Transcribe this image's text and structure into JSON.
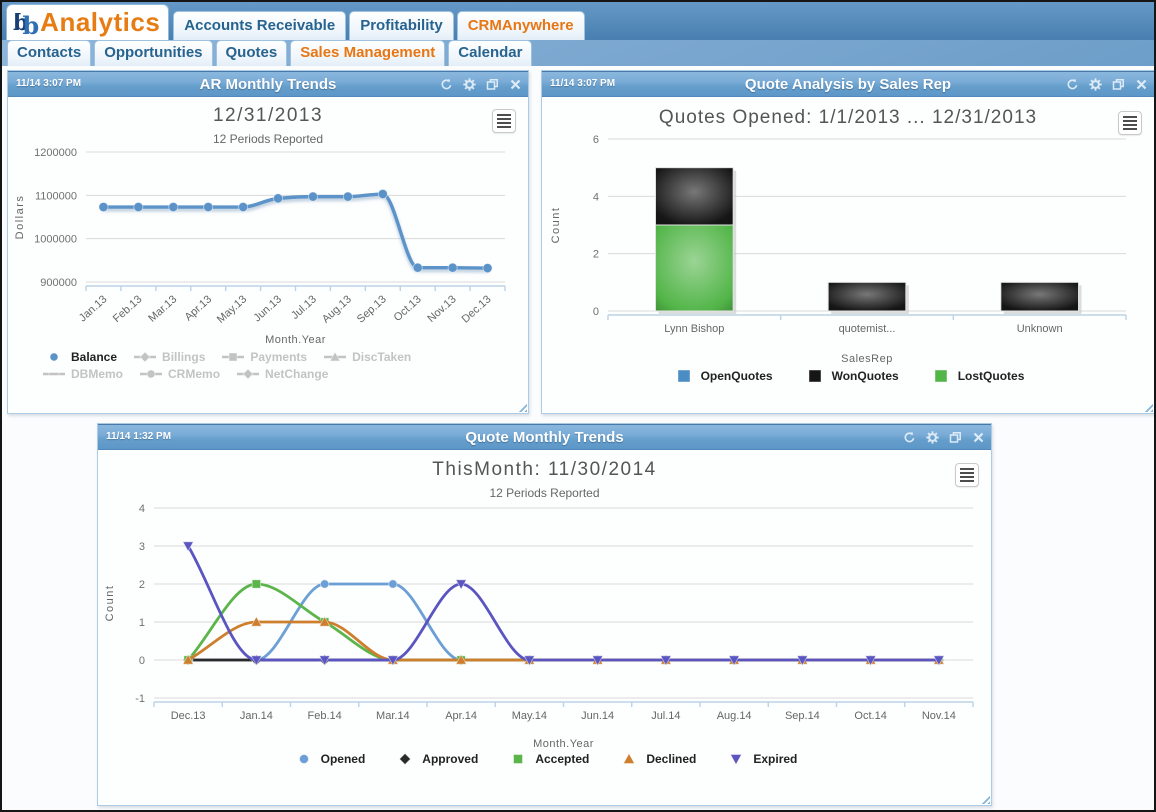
{
  "app": {
    "logo": {
      "mark_d": "d",
      "mark_b": "b",
      "text": "Analytics"
    },
    "nav_primary": [
      {
        "label": "Accounts Receivable",
        "active": false
      },
      {
        "label": "Profitability",
        "active": false
      },
      {
        "label": "CRMAnywhere",
        "active": true
      }
    ],
    "nav_secondary": [
      {
        "label": "Contacts",
        "active": false
      },
      {
        "label": "Opportunities",
        "active": false
      },
      {
        "label": "Quotes",
        "active": false
      },
      {
        "label": "Sales Management",
        "active": true
      },
      {
        "label": "Calendar",
        "active": false
      }
    ]
  },
  "panels": {
    "ar": {
      "timestamp": "11/14 3:07 PM",
      "title": "AR Monthly Trends"
    },
    "qa": {
      "timestamp": "11/14 3:07 PM",
      "title": "Quote Analysis by Sales Rep"
    },
    "qmt": {
      "timestamp": "11/14 1:32 PM",
      "title": "Quote Monthly Trends"
    }
  },
  "panel_header_icons": [
    "refresh",
    "settings",
    "popout",
    "close"
  ],
  "chart_menu_icon": "hamburger-menu",
  "chart_data": [
    {
      "id": "ar",
      "type": "line",
      "title": "12/31/2013",
      "subtitle": "12 Periods Reported",
      "xlabel": "Month.Year",
      "ylabel": "Dollars",
      "categories": [
        "Jan.13",
        "Feb.13",
        "Mar.13",
        "Apr.13",
        "May.13",
        "Jun.13",
        "Jul.13",
        "Aug.13",
        "Sep.13",
        "Oct.13",
        "Nov.13",
        "Dec.13"
      ],
      "yticks": [
        900000,
        1000000,
        1100000,
        1200000
      ],
      "ylim": [
        900000,
        1200000
      ],
      "grid": true,
      "legend_position": "bottom",
      "series": [
        {
          "name": "Balance",
          "color": "#5b93c8",
          "marker": "circle",
          "active": true,
          "values": [
            1073000,
            1073000,
            1073000,
            1073000,
            1073000,
            1093000,
            1097000,
            1097000,
            1103000,
            933000,
            933000,
            932000
          ]
        },
        {
          "name": "Billings",
          "color": "#c3c3c3",
          "marker": "diamond",
          "active": false,
          "values": null
        },
        {
          "name": "Payments",
          "color": "#c3c3c3",
          "marker": "square",
          "active": false,
          "values": null
        },
        {
          "name": "DiscTaken",
          "color": "#c3c3c3",
          "marker": "triangle-up",
          "active": false,
          "values": null
        },
        {
          "name": "DBMemo",
          "color": "#c3c3c3",
          "marker": "dash",
          "active": false,
          "values": null
        },
        {
          "name": "CRMemo",
          "color": "#c3c3c3",
          "marker": "circle",
          "active": false,
          "values": null
        },
        {
          "name": "NetChange",
          "color": "#c3c3c3",
          "marker": "diamond",
          "active": false,
          "values": null
        }
      ]
    },
    {
      "id": "qa",
      "type": "bar",
      "stacked": true,
      "title": "Quotes Opened: 1/1/2013 ... 12/31/2013",
      "xlabel": "SalesRep",
      "ylabel": "Count",
      "categories": [
        "Lynn Bishop",
        "quotemist...",
        "Unknown"
      ],
      "yticks": [
        0,
        2,
        4,
        6
      ],
      "ylim": [
        0,
        6
      ],
      "grid": true,
      "legend_position": "bottom",
      "series": [
        {
          "name": "OpenQuotes",
          "color": "#4a8cc4",
          "values": [
            0,
            0,
            0
          ]
        },
        {
          "name": "WonQuotes",
          "color": "#161616",
          "values": [
            2,
            1,
            1
          ]
        },
        {
          "name": "LostQuotes",
          "color": "#52b548",
          "values": [
            3,
            0,
            0
          ]
        }
      ]
    },
    {
      "id": "qmt",
      "type": "line",
      "title": "ThisMonth: 11/30/2014",
      "subtitle": "12 Periods Reported",
      "xlabel": "Month.Year",
      "ylabel": "Count",
      "categories": [
        "Dec.13",
        "Jan.14",
        "Feb.14",
        "Mar.14",
        "Apr.14",
        "May.14",
        "Jun.14",
        "Jul.14",
        "Aug.14",
        "Sep.14",
        "Oct.14",
        "Nov.14"
      ],
      "yticks": [
        -1,
        0,
        1,
        2,
        3,
        4
      ],
      "ylim": [
        -1,
        4
      ],
      "grid": true,
      "legend_position": "bottom",
      "series": [
        {
          "name": "Opened",
          "color": "#6b9fd6",
          "marker": "circle",
          "active": true,
          "values": [
            0,
            0,
            2,
            2,
            0,
            0,
            0,
            0,
            0,
            0,
            0,
            0
          ]
        },
        {
          "name": "Approved",
          "color": "#2a2a2a",
          "marker": "diamond",
          "active": true,
          "values": [
            0,
            0,
            0,
            0,
            0,
            0,
            0,
            0,
            0,
            0,
            0,
            0
          ]
        },
        {
          "name": "Accepted",
          "color": "#5cb54b",
          "marker": "square",
          "active": true,
          "values": [
            0,
            2,
            1,
            0,
            0,
            0,
            0,
            0,
            0,
            0,
            0,
            0
          ]
        },
        {
          "name": "Declined",
          "color": "#cd7f2e",
          "marker": "triangle-up",
          "active": true,
          "values": [
            0,
            1,
            1,
            0,
            0,
            0,
            0,
            0,
            0,
            0,
            0,
            0
          ]
        },
        {
          "name": "Expired",
          "color": "#5a55c0",
          "marker": "triangle-down",
          "active": true,
          "values": [
            3,
            0,
            0,
            0,
            2,
            0,
            0,
            0,
            0,
            0,
            0,
            0
          ]
        }
      ]
    }
  ]
}
